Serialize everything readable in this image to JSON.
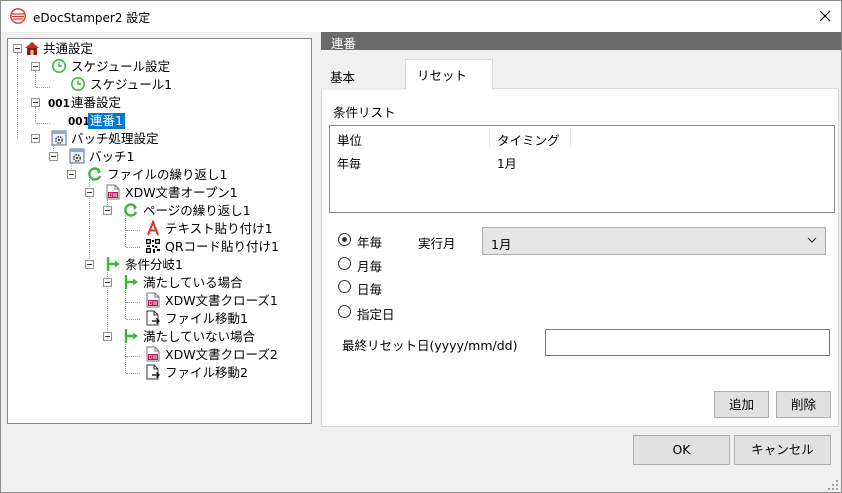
{
  "window": {
    "title": "eDocStamper2 設定",
    "close_glyph": "✕"
  },
  "tree": {
    "items": [
      {
        "label": "共通設定",
        "icon": "house-icon"
      },
      {
        "label": "スケジュール設定",
        "icon": "clock-icon"
      },
      {
        "label": "スケジュール1",
        "icon": "clock-icon"
      },
      {
        "label": "連番設定",
        "icon": "number-001-icon",
        "icon_text": "001"
      },
      {
        "label": "連番1",
        "icon": "number-001-icon",
        "icon_text": "001",
        "selected": true
      },
      {
        "label": "バッチ処理設定",
        "icon": "gear-window-icon"
      },
      {
        "label": "バッチ1",
        "icon": "gear-window-icon"
      },
      {
        "label": "ファイルの繰り返し1",
        "icon": "loop-icon"
      },
      {
        "label": "XDW文書オープン1",
        "icon": "docuworks-icon"
      },
      {
        "label": "ページの繰り返し1",
        "icon": "loop-icon"
      },
      {
        "label": "テキスト貼り付け1",
        "icon": "text-a-icon"
      },
      {
        "label": "QRコード貼り付け1",
        "icon": "qr-code-icon"
      },
      {
        "label": "条件分岐1",
        "icon": "branch-icon"
      },
      {
        "label": "満たしている場合",
        "icon": "branch-icon"
      },
      {
        "label": "XDW文書クローズ1",
        "icon": "docuworks-icon"
      },
      {
        "label": "ファイル移動1",
        "icon": "file-move-icon"
      },
      {
        "label": "満たしていない場合",
        "icon": "branch-icon"
      },
      {
        "label": "XDW文書クローズ2",
        "icon": "docuworks-icon"
      },
      {
        "label": "ファイル移動2",
        "icon": "file-move-icon"
      }
    ]
  },
  "panel": {
    "header": "連番",
    "tabs": [
      {
        "label": "基本",
        "active": false
      },
      {
        "label": "リセット",
        "active": true
      }
    ],
    "condition_list": {
      "title": "条件リスト",
      "columns": [
        "単位",
        "タイミング"
      ],
      "rows": [
        [
          "年毎",
          "1月"
        ]
      ]
    },
    "radios": [
      {
        "label": "年毎",
        "checked": true
      },
      {
        "label": "月毎",
        "checked": false
      },
      {
        "label": "日毎",
        "checked": false
      },
      {
        "label": "指定日",
        "checked": false
      }
    ],
    "exec_month": {
      "label": "実行月",
      "value": "1月"
    },
    "last_reset": {
      "label": "最終リセット日(yyyy/mm/dd)",
      "value": ""
    },
    "add_label": "追加",
    "delete_label": "削除"
  },
  "footer": {
    "ok_label": "OK",
    "cancel_label": "キャンセル"
  },
  "colors": {
    "selection": "#0078d7",
    "header_bg": "#696969",
    "icon_green": "#3cb83c",
    "icon_red": "#d9342b"
  }
}
